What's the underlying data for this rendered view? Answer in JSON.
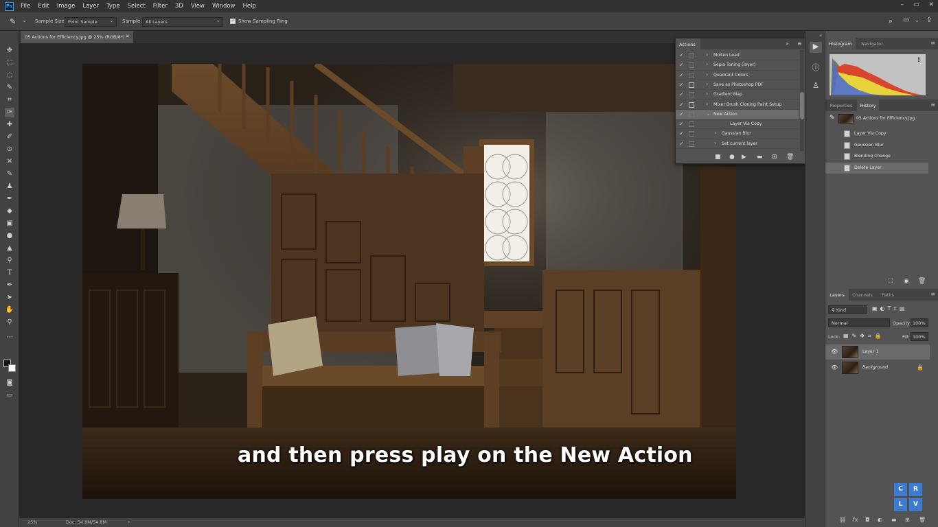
{
  "app": {
    "logo": "Ps"
  },
  "menu": [
    "File",
    "Edit",
    "Image",
    "Layer",
    "Type",
    "Select",
    "Filter",
    "3D",
    "View",
    "Window",
    "Help"
  ],
  "window_controls": [
    "–",
    "▭",
    "✕"
  ],
  "options": {
    "sample_size_label": "Sample Size:",
    "sample_size_value": "Point Sample",
    "sample_label": "Sample:",
    "sample_value": "All Layers",
    "show_ring_label": "Show Sampling Ring",
    "show_ring_checked": true
  },
  "document": {
    "tab_title": "05 Actions for Efficiency.jpg @ 25% (RGB/8*) *",
    "zoom": "25%",
    "doc_size": "Doc: 54.8M/54.8M"
  },
  "subtitle": "and then press play on the New Action",
  "actions_panel": {
    "title": "Actions",
    "rows": [
      {
        "name": "Molten Lead",
        "checked": true,
        "dialog": false,
        "expanded": false,
        "indent": 0,
        "selected": false
      },
      {
        "name": "Sepia Toning (layer)",
        "checked": true,
        "dialog": false,
        "expanded": false,
        "indent": 0,
        "selected": false
      },
      {
        "name": "Quadrant Colors",
        "checked": true,
        "dialog": false,
        "expanded": false,
        "indent": 0,
        "selected": false
      },
      {
        "name": "Save as Photoshop PDF",
        "checked": true,
        "dialog": true,
        "expanded": false,
        "indent": 0,
        "selected": false
      },
      {
        "name": "Gradient Map",
        "checked": true,
        "dialog": false,
        "expanded": false,
        "indent": 0,
        "selected": false
      },
      {
        "name": "Mixer Brush Cloning Paint Setup",
        "checked": true,
        "dialog": true,
        "expanded": false,
        "indent": 0,
        "selected": false
      },
      {
        "name": "New Action",
        "checked": true,
        "dialog": false,
        "expanded": true,
        "indent": 0,
        "selected": true
      },
      {
        "name": "Layer Via Copy",
        "checked": true,
        "dialog": false,
        "expanded": null,
        "indent": 2,
        "selected": false
      },
      {
        "name": "Gaussian Blur",
        "checked": true,
        "dialog": false,
        "expanded": false,
        "indent": 1,
        "selected": false
      },
      {
        "name": "Set current layer",
        "checked": true,
        "dialog": false,
        "expanded": false,
        "indent": 1,
        "selected": false
      }
    ]
  },
  "history_panel": {
    "tabs": [
      "Properties",
      "History"
    ],
    "active_tab": "History",
    "snapshot": "05 Actions for Efficiency.jpg",
    "states": [
      "Layer Via Copy",
      "Gaussian Blur",
      "Blending Change",
      "Delete Layer"
    ],
    "selected_state": "Delete Layer"
  },
  "histogram_panel": {
    "tabs": [
      "Histogram",
      "Navigator"
    ],
    "active_tab": "Histogram",
    "warning": "!"
  },
  "layers_panel": {
    "tabs": [
      "Layers",
      "Channels",
      "Paths"
    ],
    "active_tab": "Layers",
    "filter_kind": "Kind",
    "blend_mode": "Normal",
    "opacity_label": "Opacity:",
    "opacity": "100%",
    "lock_label": "Lock:",
    "fill_label": "Fill:",
    "fill": "100%",
    "layers": [
      {
        "name": "Layer 1",
        "visible": true,
        "selected": true,
        "locked": false
      },
      {
        "name": "Background",
        "visible": true,
        "selected": false,
        "locked": true
      }
    ]
  },
  "watermark": [
    "C",
    "R",
    "L",
    "V"
  ],
  "colors": {
    "accent_blue": "#3b7bd1",
    "ps_blue": "#31a8ff"
  }
}
